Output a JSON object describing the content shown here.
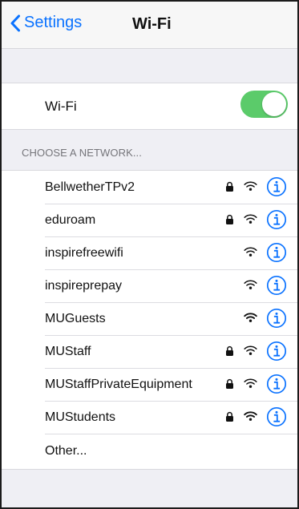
{
  "nav": {
    "back_label": "Settings",
    "title": "Wi-Fi"
  },
  "wifi_toggle": {
    "label": "Wi-Fi",
    "on": true,
    "color": "#5bcb6a"
  },
  "section": {
    "header": "CHOOSE A NETWORK..."
  },
  "networks": [
    {
      "name": "BellwetherTPv2",
      "locked": true,
      "signal": "medium"
    },
    {
      "name": "eduroam",
      "locked": true,
      "signal": "medium"
    },
    {
      "name": "inspirefreewifi",
      "locked": false,
      "signal": "medium"
    },
    {
      "name": "inspireprepay",
      "locked": false,
      "signal": "medium"
    },
    {
      "name": "MUGuests",
      "locked": false,
      "signal": "strong"
    },
    {
      "name": "MUStaff",
      "locked": true,
      "signal": "medium"
    },
    {
      "name": "MUStaffPrivateEquipment",
      "locked": true,
      "signal": "medium"
    },
    {
      "name": "MUStudents",
      "locked": true,
      "signal": "strong"
    }
  ],
  "other": {
    "label": "Other..."
  },
  "colors": {
    "accent": "#0a72ff",
    "background": "#efeff4"
  }
}
